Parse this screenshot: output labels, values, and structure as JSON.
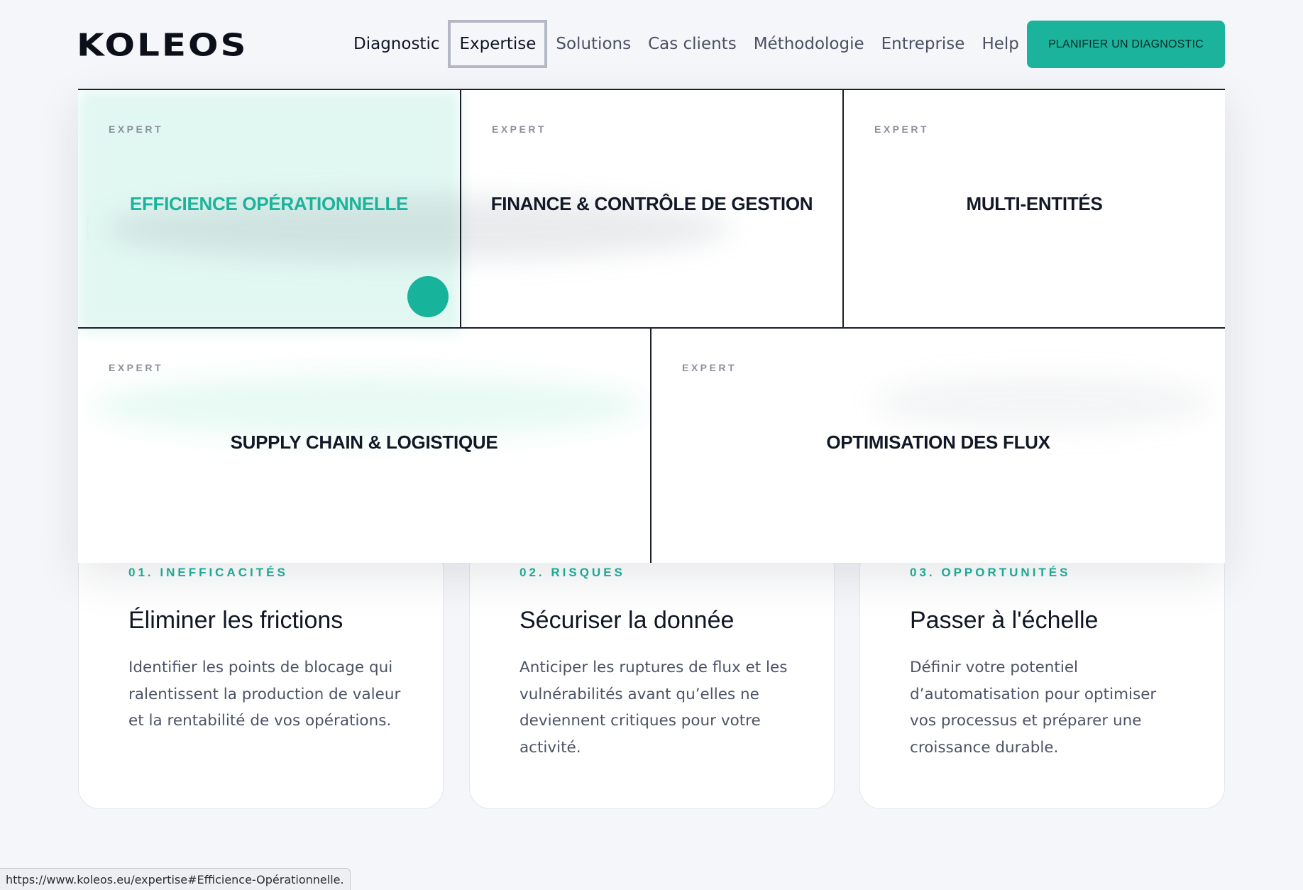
{
  "header": {
    "logo": "KOLEOS",
    "nav": [
      {
        "label": "Diagnostic"
      },
      {
        "label": "Expertise"
      },
      {
        "label": "Solutions"
      },
      {
        "label": "Cas clients"
      },
      {
        "label": "Méthodologie"
      },
      {
        "label": "Entreprise"
      },
      {
        "label": "Help"
      }
    ],
    "cta_label": "PLANIFIER UN DIAGNOSTIC"
  },
  "mega_menu": {
    "items": [
      {
        "kicker": "EXPERT",
        "title": "EFFICIENCE OPÉRATIONNELLE",
        "active": true
      },
      {
        "kicker": "EXPERT",
        "title": "FINANCE & CONTRÔLE DE GESTION"
      },
      {
        "kicker": "EXPERT",
        "title": "MULTI-ENTITÉS"
      },
      {
        "kicker": "EXPERT",
        "title": "SUPPLY CHAIN & LOGISTIQUE"
      },
      {
        "kicker": "EXPERT",
        "title": "OPTIMISATION DES FLUX"
      }
    ]
  },
  "cards": [
    {
      "kicker": "01. INEFFICACITÉS",
      "title": "Éliminer les frictions",
      "body": "Identifier les points de blocage qui ralentissent la production de valeur et la rentabilité de vos opérations."
    },
    {
      "kicker": "02. RISQUES",
      "title": "Sécuriser la donnée",
      "body": "Anticiper les ruptures de flux et les vulnérabilités avant qu’elles ne deviennent critiques pour votre activité."
    },
    {
      "kicker": "03. OPPORTUNITÉS",
      "title": "Passer à l'échelle",
      "body": "Définir votre potentiel d’automatisation pour optimiser vos processus et préparer une croissance durable."
    }
  ],
  "status_bar": {
    "url": "https://www.koleos.eu/expertise#Efficience-Opérationnelle."
  },
  "colors": {
    "accent": "#1bb39b",
    "text_dark": "#131827",
    "background": "#f5f6f9"
  }
}
